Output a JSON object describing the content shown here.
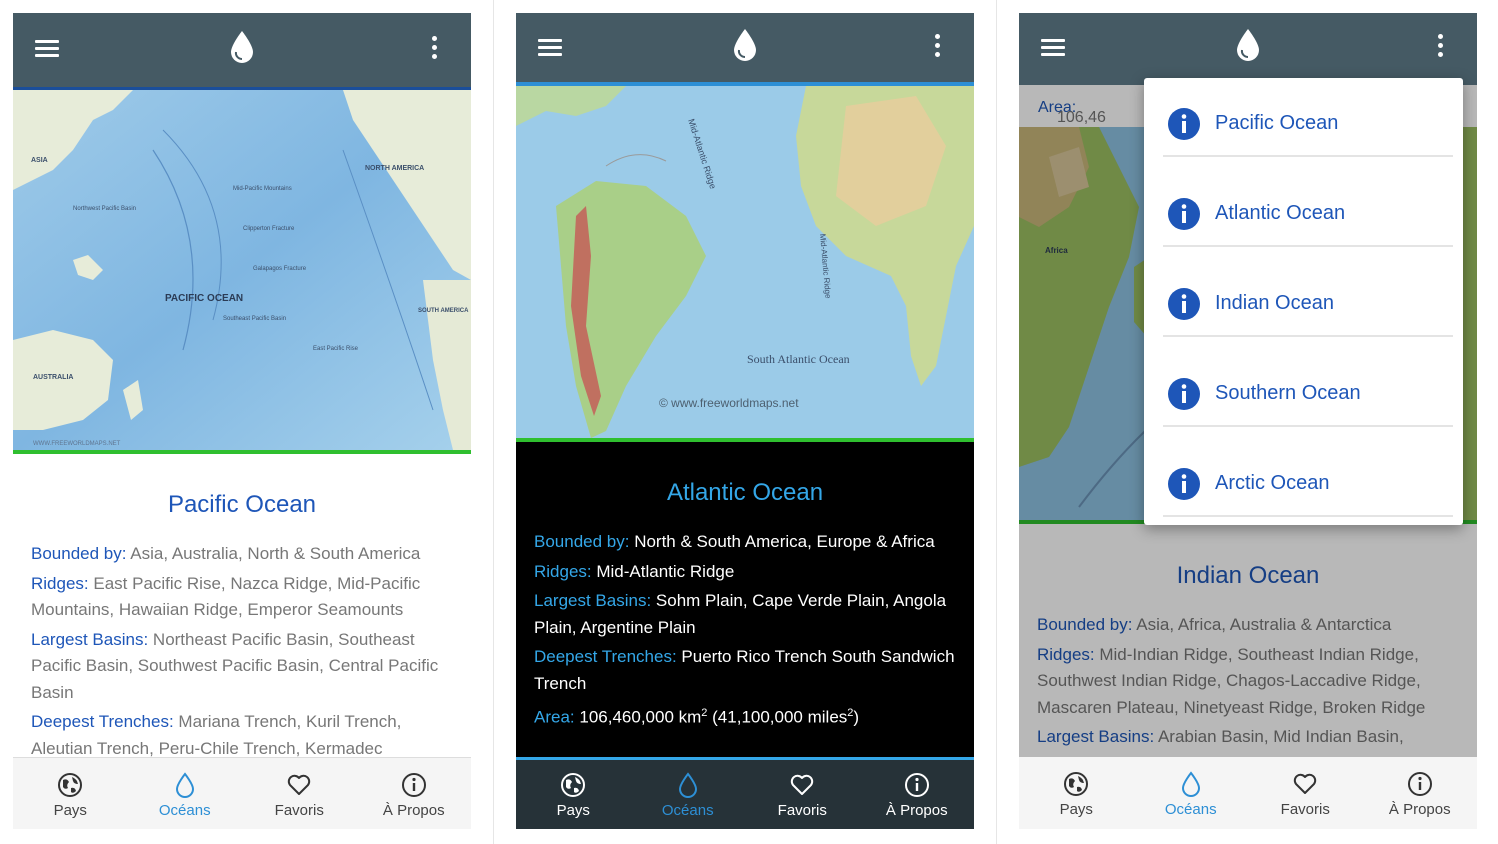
{
  "screens": [
    {
      "ocean": "Pacific Ocean",
      "bounded_by": "Bounded by:",
      "bounded_by_value": " Asia, Australia, North & South America",
      "ridges": "Ridges:",
      "ridges_value": " East Pacific Rise, Nazca Ridge, Mid-Pacific Mountains, Hawaiian Ridge, Emperor Seamounts",
      "basins": "Largest Basins:",
      "basins_value": " Northeast Pacific Basin, Southeast Pacific Basin, Southwest Pacific Basin, Central Pacific Basin",
      "trenches": "Deepest Trenches:",
      "trenches_value": " Mariana Trench, Kuril Trench, Aleutian Trench, Peru-Chile Trench, Kermadec",
      "map_labels": {
        "asia": "ASIA",
        "north_america": "NORTH AMERICA",
        "pacific_ocean": "PACIFIC OCEAN",
        "australia": "AUSTRALIA",
        "south_america": "SOUTH AMERICA",
        "credit": "WWW.FREEWORLDMAPS.NET"
      }
    },
    {
      "ocean": "Atlantic Ocean",
      "bounded_by": "Bounded by:",
      "bounded_by_value": " North & South America, Europe & Africa",
      "ridges": "Ridges:",
      "ridges_value": " Mid-Atlantic Ridge",
      "basins": "Largest Basins:",
      "basins_value": " Sohm Plain, Cape Verde Plain, Angola Plain, Argentine Plain",
      "trenches": "Deepest Trenches:",
      "trenches_value": " Puerto Rico Trench South Sandwich Trench",
      "area": "Area:",
      "area_value": " 106,460,000 km",
      "area_unit_sup": "2",
      "area_miles": " (41,100,000 miles",
      "area_miles_sup": "2",
      "area_close": ")",
      "map_labels": {
        "mid_atlantic_ridge": "Mid-Atlantic Ridge",
        "mid_atlantic_ridge_2": "Mid-Atlantic Ridge",
        "south_atlantic_ocean": "South Atlantic Ocean",
        "credit": "© www.freeworldmaps.net"
      }
    },
    {
      "ocean": "Indian Ocean",
      "area_partial": "Area:",
      "area_partial_value": " 106,46",
      "bounded_by": "Bounded by:",
      "bounded_by_value": " Asia, Africa, Australia & Antarctica",
      "ridges": "Ridges:",
      "ridges_value": " Mid-Indian Ridge, Southeast Indian Ridge, Southwest Indian Ridge, Chagos-Laccadive Ridge, Mascaren Plateau, Ninetyeast Ridge, Broken Ridge",
      "basins": "Largest Basins:",
      "basins_value": " Arabian Basin, Mid Indian Basin,",
      "map_labels": {
        "africa": "Africa"
      },
      "menu": [
        "Pacific Ocean",
        "Atlantic Ocean",
        "Indian Ocean",
        "Southern Ocean",
        "Arctic Ocean"
      ]
    }
  ],
  "nav": {
    "pays": "Pays",
    "oceans": "Océans",
    "favoris": "Favoris",
    "apropos": "À Propos"
  },
  "icons": [
    "menu-icon",
    "water-drop-icon",
    "more-vert-icon",
    "globe-icon",
    "drop-outline-icon",
    "heart-icon",
    "info-icon"
  ],
  "colors": {
    "toolbar": "#455a64",
    "accent_blue": "#1e56b8",
    "light_blue": "#34a7e8",
    "green": "#2fbf2f"
  }
}
